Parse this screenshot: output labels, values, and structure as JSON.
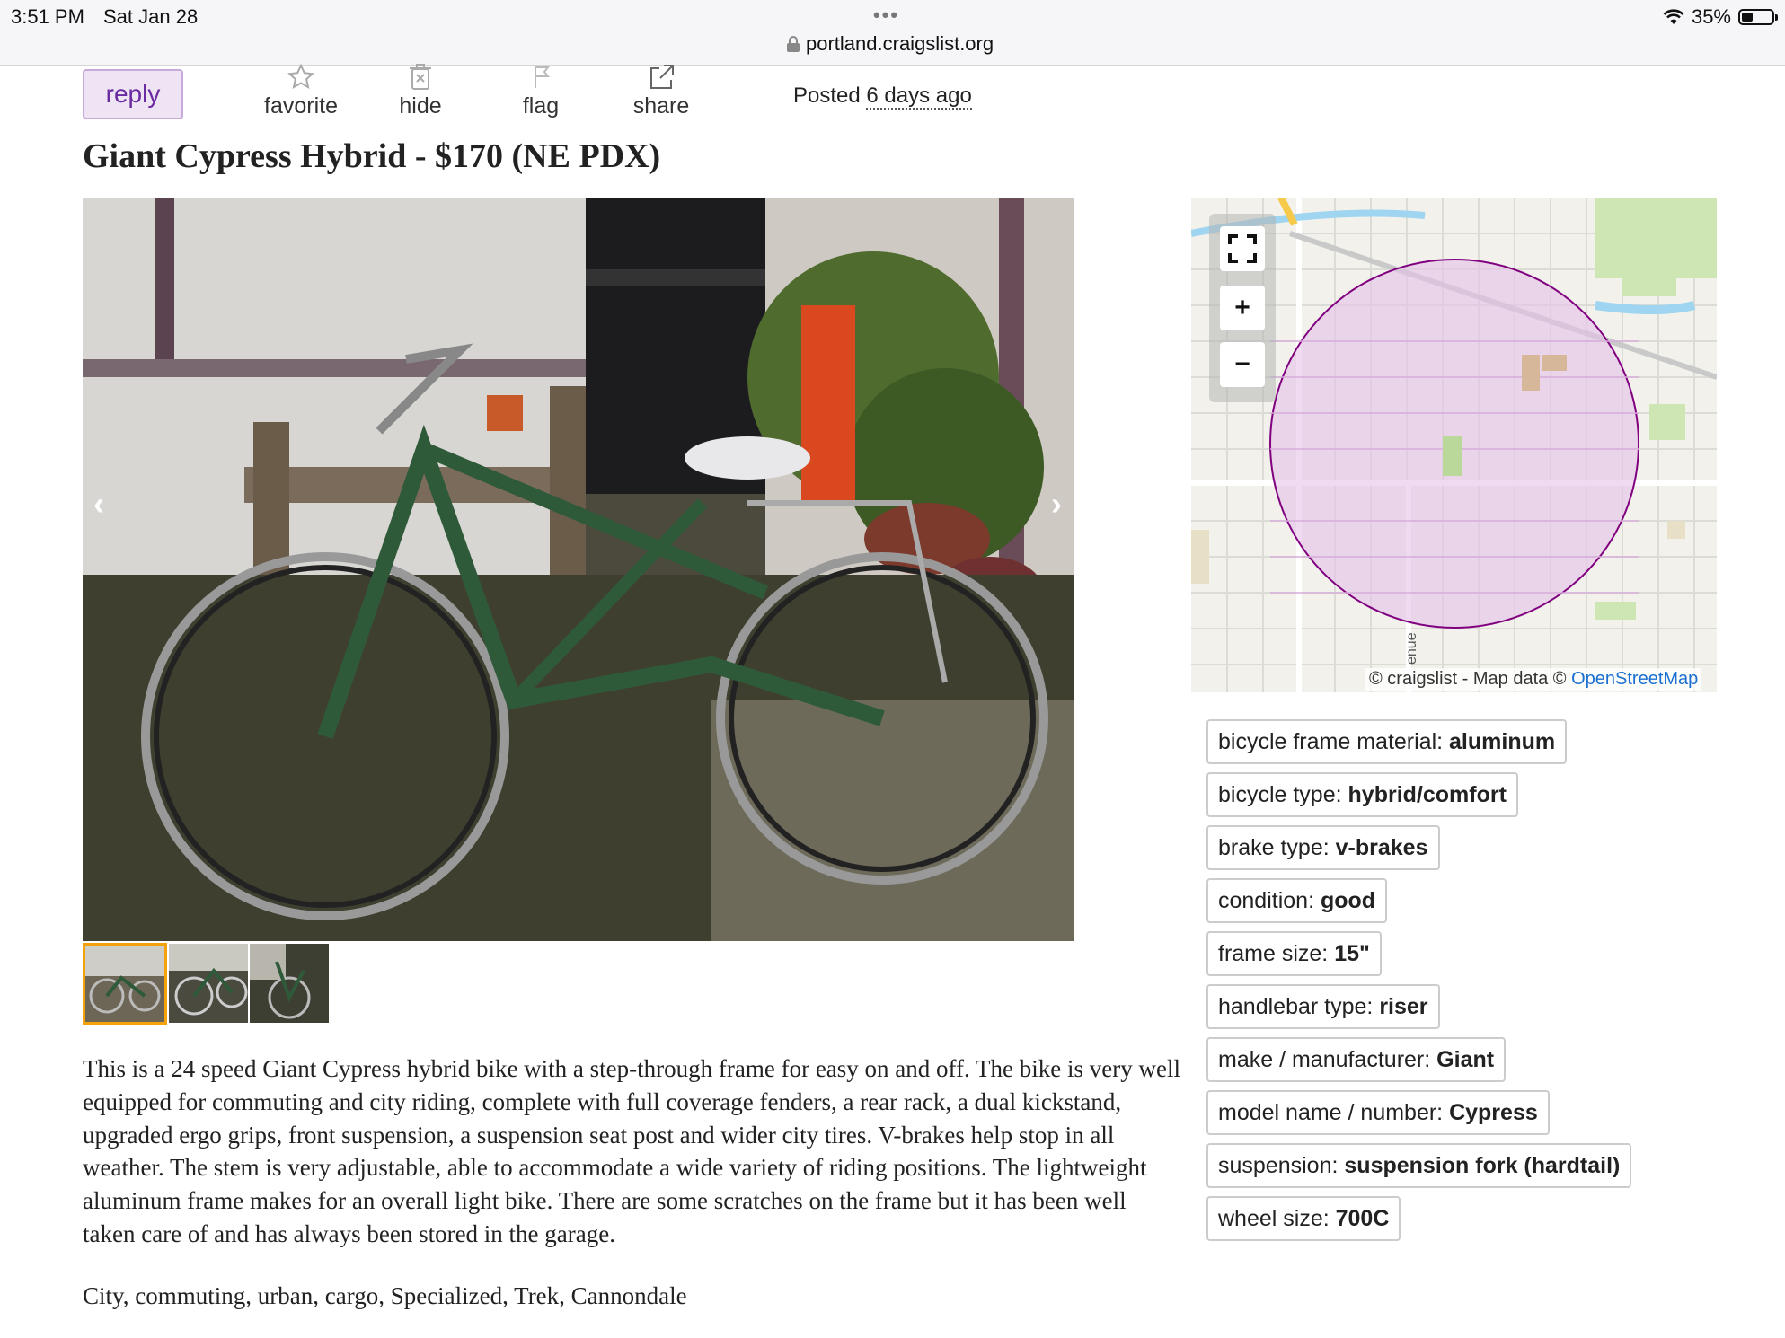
{
  "status_bar": {
    "time": "3:51 PM",
    "date": "Sat Jan 28",
    "dots": "•••",
    "url": "portland.craigslist.org",
    "battery": "35%"
  },
  "actions": {
    "reply": "reply",
    "favorite": "favorite",
    "hide": "hide",
    "flag": "flag",
    "share": "share"
  },
  "posted": {
    "prefix": "Posted",
    "ago": "6 days ago"
  },
  "title": "Giant Cypress Hybrid - $170 (NE PDX)",
  "gallery": {
    "prev": "‹",
    "next": "›",
    "thumbnail_count": 3,
    "active_thumbnail": 1
  },
  "map": {
    "attribution_prefix": "© craigslist - Map data ©",
    "attribution_link": "OpenStreetMap",
    "street_fragment": "enue",
    "zoom_in": "+",
    "zoom_out": "−",
    "colors": {
      "circle": "#800080",
      "circle_fill": "#e9c9ec"
    }
  },
  "attributes": [
    {
      "label": "bicycle frame material:",
      "value": "aluminum"
    },
    {
      "label": "bicycle type:",
      "value": "hybrid/comfort"
    },
    {
      "label": "brake type:",
      "value": "v-brakes"
    },
    {
      "label": "condition:",
      "value": "good"
    },
    {
      "label": "frame size:",
      "value": "15\""
    },
    {
      "label": "handlebar type:",
      "value": "riser"
    },
    {
      "label": "make / manufacturer:",
      "value": "Giant"
    },
    {
      "label": "model name / number:",
      "value": "Cypress"
    },
    {
      "label": "suspension:",
      "value": "suspension fork (hardtail)"
    },
    {
      "label": "wheel size:",
      "value": "700C"
    }
  ],
  "description": "This is a 24 speed Giant Cypress hybrid bike with a step-through frame for easy on and off. The bike is very well equipped for commuting and city riding, complete with full coverage fenders, a rear rack, a dual kickstand, upgraded ergo grips, front suspension, a suspension seat post and wider city tires. V-brakes help stop in all weather. The stem is very adjustable, able to accommodate a wide variety of riding positions. The lightweight aluminum frame makes for an overall light bike. There are some scratches on the frame but it has been well taken care of and has always been stored in the garage.",
  "tags": "City, commuting, urban, cargo, Specialized, Trek, Cannondale",
  "colors": {
    "reply_bg": "#eee4f3",
    "reply_text": "#6a2aa1",
    "active_thumb": "#f4a20b",
    "link": "#1a6fd0"
  }
}
